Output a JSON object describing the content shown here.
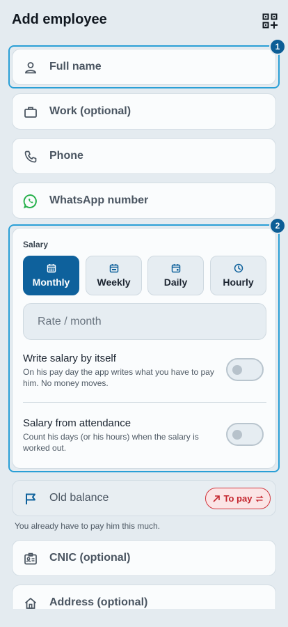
{
  "header": {
    "title": "Add employee",
    "action_icon": "qr-add-icon"
  },
  "fields": {
    "full_name": "Full name",
    "work": "Work (optional)",
    "phone": "Phone",
    "whatsapp": "WhatsApp number",
    "cnic": "CNIC (optional)",
    "address": "Address (optional)"
  },
  "badges": {
    "first": "1",
    "second": "2"
  },
  "salary": {
    "title": "Salary",
    "periods": [
      {
        "label": "Monthly",
        "active": true
      },
      {
        "label": "Weekly",
        "active": false
      },
      {
        "label": "Daily",
        "active": false
      },
      {
        "label": "Hourly",
        "active": false
      }
    ],
    "rate_placeholder": "Rate / month",
    "auto_write": {
      "title": "Write salary by itself",
      "subtitle": "On his pay day the app writes what you have to pay him. No money moves.",
      "enabled": false
    },
    "attendance": {
      "title": "Salary from attendance",
      "subtitle": "Count his days (or his hours) when the salary is worked out.",
      "enabled": false
    }
  },
  "balance": {
    "label": "Old balance",
    "direction": "To pay",
    "hint": "You already have to pay him this much."
  },
  "colors": {
    "accent": "#0e619c",
    "highlight": "#2a9fd6",
    "danger": "#c4252d",
    "whatsapp": "#25b04a",
    "background": "#e4ebf0"
  }
}
